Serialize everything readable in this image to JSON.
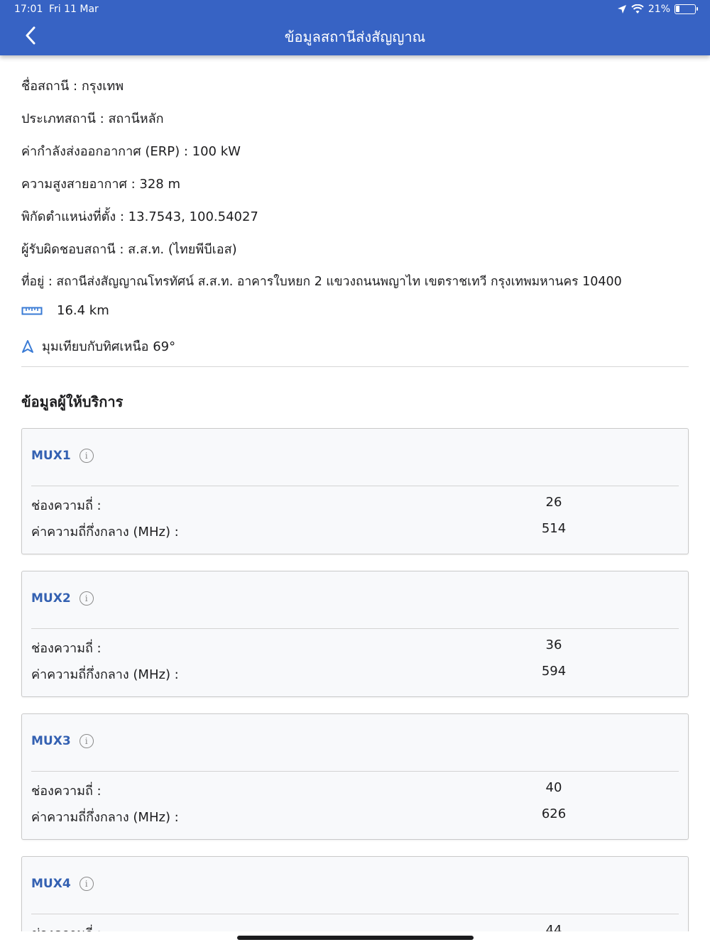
{
  "status_bar": {
    "time": "17:01",
    "date": "Fri 11 Mar",
    "battery": "21%",
    "battery_level": 0.21
  },
  "header": {
    "title": "ข้อมูลสถานีส่งสัญญาณ"
  },
  "station": {
    "name": "ชื่อสถานี : กรุงเทพ",
    "type": "ประเภทสถานี : สถานีหลัก",
    "erp": "ค่ากำลังส่งออกอากาศ (ERP) : 100 kW",
    "antenna_height": "ความสูงสายอากาศ : 328 m",
    "coordinates": "พิกัดตำแหน่งที่ตั้ง : 13.7543, 100.54027",
    "operator": "ผู้รับผิดชอบสถานี : ส.ส.ท. (ไทยพีบีเอส)",
    "address": "ที่อยู่ : สถานีส่งสัญญาณโทรทัศน์  ส.ส.ท. อาคารใบหยก 2 แขวงถนนพญาไท เขตราชเทวี กรุงเทพมหานคร 10400",
    "distance": "16.4 km",
    "bearing": "มุมเทียบกับทิศเหนือ 69°"
  },
  "providers": {
    "title": "ข้อมูลผู้ให้บริการ",
    "channel_label": "ช่องความถี่ :",
    "freq_label": "ค่าความถี่กึ่งกลาง (MHz) :",
    "mux": [
      {
        "name": "MUX1",
        "channel": "26",
        "frequency": "514"
      },
      {
        "name": "MUX2",
        "channel": "36",
        "frequency": "594"
      },
      {
        "name": "MUX3",
        "channel": "40",
        "frequency": "626"
      },
      {
        "name": "MUX4",
        "channel": "44",
        "frequency": ""
      }
    ]
  }
}
